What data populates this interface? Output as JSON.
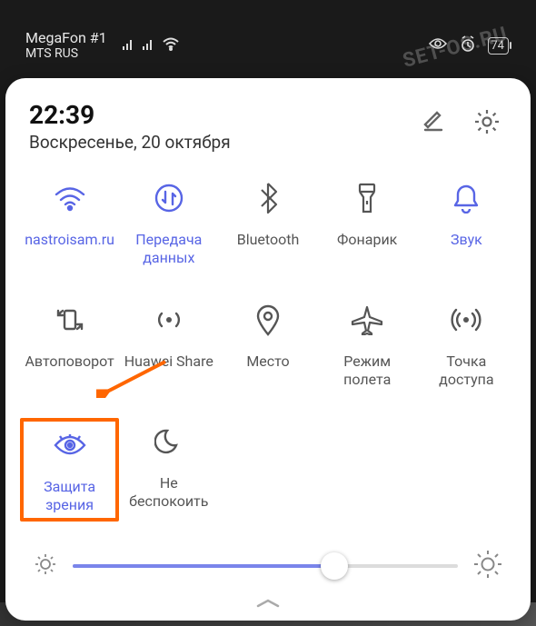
{
  "statusbar": {
    "carrier1": "MegaFon #1",
    "carrier2": "MTS RUS",
    "battery": "74"
  },
  "header": {
    "time": "22:39",
    "date": "Воскресенье, 20 октября"
  },
  "tiles": [
    {
      "label": "nastroisam.ru",
      "icon": "wifi-icon",
      "active": true
    },
    {
      "label": "Передача данных",
      "icon": "data-icon",
      "active": true
    },
    {
      "label": "Bluetooth",
      "icon": "bluetooth-icon",
      "active": false
    },
    {
      "label": "Фонарик",
      "icon": "flashlight-icon",
      "active": false
    },
    {
      "label": "Звук",
      "icon": "sound-bell-icon",
      "active": true
    },
    {
      "label": "Автоповорот",
      "icon": "rotate-icon",
      "active": false
    },
    {
      "label": "Huawei Share",
      "icon": "share-broadcast-icon",
      "active": false
    },
    {
      "label": "Место",
      "icon": "location-pin-icon",
      "active": false
    },
    {
      "label": "Режим полета",
      "icon": "airplane-icon",
      "active": false
    },
    {
      "label": "Точка доступа",
      "icon": "hotspot-icon",
      "active": false
    },
    {
      "label": "Защита зрения",
      "icon": "eye-icon",
      "active": true,
      "highlighted": true
    },
    {
      "label": "Не беспокоить",
      "icon": "dnd-moon-icon",
      "active": false
    }
  ],
  "brightness": {
    "percent": 68
  },
  "annotations": {
    "arrow_to": "Защита зрения"
  },
  "colors": {
    "accent": "#5865e5",
    "highlight": "#ff6600"
  },
  "watermark": "SET-OS.RU"
}
